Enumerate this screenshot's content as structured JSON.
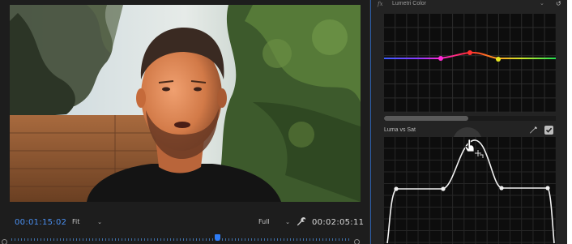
{
  "program_monitor": {
    "current_timecode": "00:01:15:02",
    "zoom_select": "Fit",
    "resolution_select": "Full",
    "duration_timecode": "00:02:05:11"
  },
  "lumetri": {
    "panel_title": "Lumetri Color",
    "fx_label": "fx",
    "section_title": "Luma vs Sat",
    "section_enabled": true
  },
  "colors": {
    "timecode_blue": "#4a8ff0",
    "playhead_blue": "#2e7cf6"
  }
}
